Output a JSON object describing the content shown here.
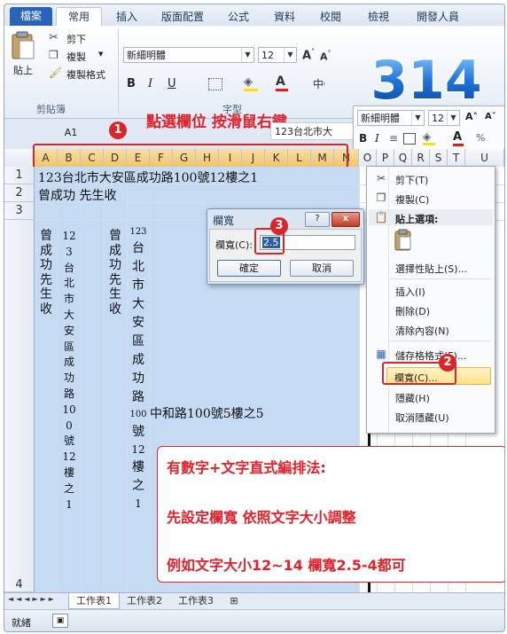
{
  "ribbon": {
    "tabs": [
      "檔案",
      "常用",
      "插入",
      "版面配置",
      "公式",
      "資料",
      "校閱",
      "檢視",
      "開發人員"
    ],
    "clipboard": {
      "paste": "貼上",
      "cut": "剪下",
      "copy": "複製",
      "format_painter": "複製格式",
      "group": "剪貼簿"
    },
    "font": {
      "name": "新細明體",
      "size": "12",
      "group": "字型",
      "bold": "B",
      "italic": "I",
      "underline": "U"
    },
    "logo_text": "314"
  },
  "formula": {
    "name_box": "A1",
    "content": "123台北市大"
  },
  "annotation_title": "點選欄位 按滑鼠右鍵",
  "mini_toolbar": {
    "font": "新細明體",
    "size": "12"
  },
  "columns": [
    "A",
    "B",
    "C",
    "D",
    "E",
    "F",
    "G",
    "H",
    "I",
    "J",
    "K",
    "L",
    "M",
    "N",
    "O",
    "P",
    "Q",
    "R",
    "S",
    "T",
    "U"
  ],
  "rows": [
    "1",
    "2",
    "3",
    "4"
  ],
  "cells": {
    "a1": "123台北市大安區成功路100號12樓之1",
    "a2": "曾成功 先生收",
    "c3_overflow": "中和路100號5樓之5"
  },
  "vertical": {
    "col_a": "曾成功　先生收",
    "col_b": "123台北市大安區成功路100號12樓之1",
    "col_d": "曾成功　先生收",
    "col_e": [
      "123",
      "台",
      "北",
      "市",
      "大",
      "安",
      "區",
      "成",
      "功",
      "路",
      "100",
      "號",
      "12",
      "樓",
      "之",
      "1"
    ]
  },
  "dialog": {
    "title": "欄寬",
    "help": "?",
    "close": "x",
    "label": "欄寬(C):",
    "value": "2.5",
    "ok": "確定",
    "cancel": "取消"
  },
  "context_menu": [
    {
      "label": "剪下(T)",
      "icon": "scissors-icon"
    },
    {
      "label": "複製(C)",
      "icon": "copy-icon"
    },
    {
      "label": "貼上選項:",
      "icon": "paste-icon"
    },
    {
      "label": "選擇性貼上(S)...",
      "icon": ""
    },
    {
      "label": "插入(I)",
      "icon": ""
    },
    {
      "label": "刪除(D)",
      "icon": ""
    },
    {
      "label": "清除內容(N)",
      "icon": ""
    },
    {
      "label": "儲存格格式(F)...",
      "icon": "format-icon"
    },
    {
      "label": "欄寬(C)...",
      "icon": ""
    },
    {
      "label": "隱藏(H)",
      "icon": ""
    },
    {
      "label": "取消隱藏(U)",
      "icon": ""
    }
  ],
  "tip": {
    "line1": "有數字+文字直式編排法:",
    "line2": "先設定欄寬 依照文字大小調整",
    "line3": "例如文字大小12~14 欄寬2.5-4都可"
  },
  "badges": [
    "1",
    "2",
    "3"
  ],
  "sheets": [
    "工作表1",
    "工作表2",
    "工作表3"
  ],
  "status": {
    "ready": "就緒"
  },
  "colors": {
    "accent": "#d8262a",
    "selection": "#c5dbf4",
    "header_selected": "#f0c56a",
    "file_tab": "#2a62b9"
  }
}
